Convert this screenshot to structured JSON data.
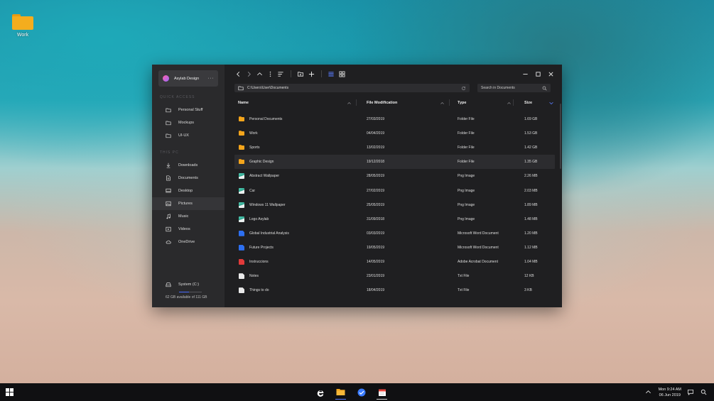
{
  "desktop": {
    "icon_label": "Work",
    "icon_name": "folder-icon"
  },
  "sidebar": {
    "account_name": "Asylab Design",
    "more_label": "···",
    "quick_access_label": "QUICK ACCESS",
    "quick_access": [
      {
        "label": "Personal Stuff",
        "icon": "folder-icon"
      },
      {
        "label": "Mockups",
        "icon": "folder-icon"
      },
      {
        "label": "UI-UX",
        "icon": "folder-icon"
      }
    ],
    "this_pc_label": "THIS PC",
    "this_pc": [
      {
        "label": "Downloads",
        "icon": "download-icon"
      },
      {
        "label": "Documents",
        "icon": "document-icon"
      },
      {
        "label": "Desktop",
        "icon": "desktop-icon"
      },
      {
        "label": "Pictures",
        "icon": "image-icon"
      },
      {
        "label": "Music",
        "icon": "music-icon"
      },
      {
        "label": "Videos",
        "icon": "video-icon"
      },
      {
        "label": "OneDrive",
        "icon": "cloud-icon"
      }
    ],
    "active_item": "Pictures",
    "drive": {
      "label": "System (C:)",
      "caption": "62 GB available of 111 GB",
      "used_fraction": 0.44
    }
  },
  "address": {
    "path": "C:\\Users\\User\\Documents"
  },
  "search": {
    "placeholder": "Search in Documents"
  },
  "columns": [
    "Name",
    "File Modification",
    "Type",
    "Size"
  ],
  "files": [
    {
      "name": "Personal Documents",
      "modified": "27/03/2019",
      "type": "Folder File",
      "size": "1.69 GB",
      "kind": "folder"
    },
    {
      "name": "Work",
      "modified": "04/04/2019",
      "type": "Folder File",
      "size": "1.53 GB",
      "kind": "folder"
    },
    {
      "name": "Sports",
      "modified": "13/02/2019",
      "type": "Folder File",
      "size": "1.42 GB",
      "kind": "folder"
    },
    {
      "name": "Graphic Design",
      "modified": "19/12/2018",
      "type": "Folder File",
      "size": "1.35 GB",
      "kind": "folder"
    },
    {
      "name": "Abstract Wallpaper",
      "modified": "28/05/2019",
      "type": "Png Image",
      "size": "2.26 MB",
      "kind": "png"
    },
    {
      "name": "Car",
      "modified": "27/02/2019",
      "type": "Png Image",
      "size": "2.03 MB",
      "kind": "png"
    },
    {
      "name": "Windows 11 Wallpaper",
      "modified": "25/05/2019",
      "type": "Png Image",
      "size": "1.89 MB",
      "kind": "png"
    },
    {
      "name": "Logo Asylab",
      "modified": "31/09/2018",
      "type": "Png Image",
      "size": "1.48 MB",
      "kind": "png"
    },
    {
      "name": "Global Industrial Analysis",
      "modified": "03/03/2019",
      "type": "Microsoft Word Document",
      "size": "1.20 MB",
      "kind": "word"
    },
    {
      "name": "Future Projects",
      "modified": "19/05/2019",
      "type": "Microsoft Word Document",
      "size": "1.12 MB",
      "kind": "word"
    },
    {
      "name": "Instruccions",
      "modified": "14/05/2019",
      "type": "Adobe Acrobat Document",
      "size": "1.04 MB",
      "kind": "pdf"
    },
    {
      "name": "Notes",
      "modified": "23/01/2019",
      "type": "Txt File",
      "size": "12 KB",
      "kind": "txt"
    },
    {
      "name": "Things to do",
      "modified": "18/04/2019",
      "type": "Txt File",
      "size": "3 KB",
      "kind": "txt"
    }
  ],
  "selected_file": "Graphic Design",
  "taskbar": {
    "time": "Mon 9:24 AM",
    "date": "06 Jun 2019",
    "apps": [
      "edge-icon",
      "file-explorer-icon",
      "mail-icon",
      "calendar-icon"
    ]
  },
  "colors": {
    "accent": "#4a6cff",
    "folder": "#f3a51c",
    "window_bg": "#1f1f21",
    "sidebar_bg": "#2a2a2c"
  }
}
